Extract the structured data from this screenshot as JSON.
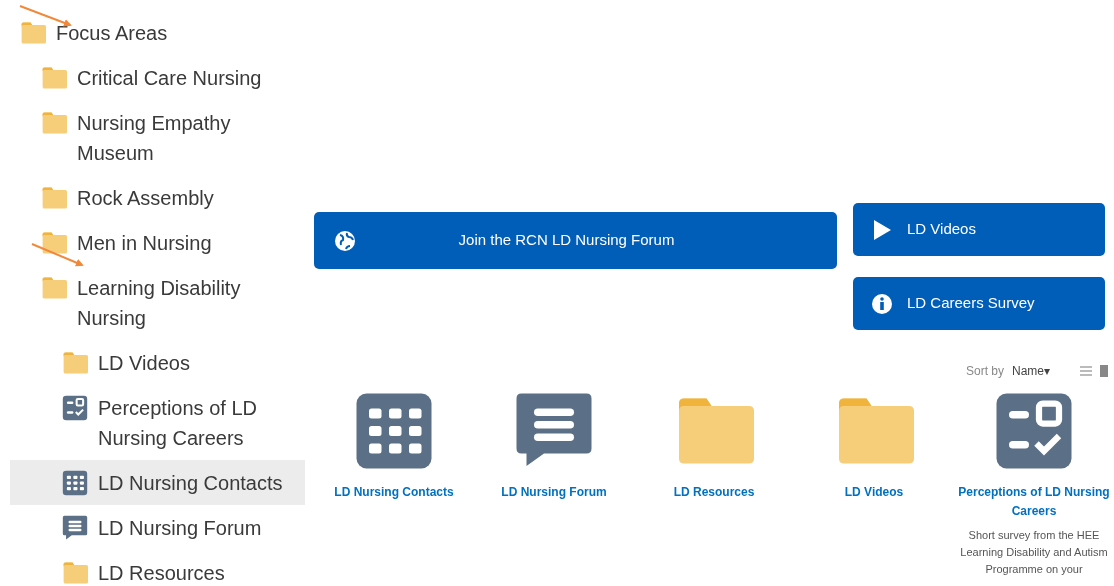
{
  "tree": [
    {
      "label": "Focus Areas",
      "kind": "folder",
      "selected": false,
      "children": [
        {
          "label": "Critical Care Nursing",
          "kind": "folder",
          "selected": false
        },
        {
          "label": "Nursing Empathy Museum",
          "kind": "folder",
          "selected": false
        },
        {
          "label": "Rock Assembly",
          "kind": "folder",
          "selected": false
        },
        {
          "label": "Men in Nursing",
          "kind": "folder",
          "selected": false
        },
        {
          "label": "Learning Disability Nursing",
          "kind": "folder",
          "selected": false,
          "children": [
            {
              "label": "LD Videos",
              "kind": "folder",
              "selected": false
            },
            {
              "label": "Perceptions of LD Nursing Careers",
              "kind": "survey",
              "selected": false
            },
            {
              "label": "LD Nursing Contacts",
              "kind": "grid",
              "selected": true
            },
            {
              "label": "LD Nursing Forum",
              "kind": "forum",
              "selected": false
            },
            {
              "label": "LD Resources",
              "kind": "folder",
              "selected": false
            }
          ]
        }
      ]
    }
  ],
  "main_button": {
    "label": "Join the RCN LD Nursing Forum",
    "kind": "globe"
  },
  "side_buttons": [
    {
      "label": "LD Videos",
      "kind": "play"
    },
    {
      "label": "LD Careers Survey",
      "kind": "info"
    }
  ],
  "sort": {
    "label": "Sort by",
    "value": "Name▾"
  },
  "tiles": [
    {
      "label": "LD Nursing Contacts",
      "kind": "grid"
    },
    {
      "label": "LD Nursing Forum",
      "kind": "forum"
    },
    {
      "label": "LD Resources",
      "kind": "folder"
    },
    {
      "label": "LD Videos",
      "kind": "folder"
    },
    {
      "label": "Perceptions of LD Nursing Careers",
      "kind": "survey",
      "description": "Short survey from the HEE Learning Disability and Autism Programme on your"
    }
  ]
}
